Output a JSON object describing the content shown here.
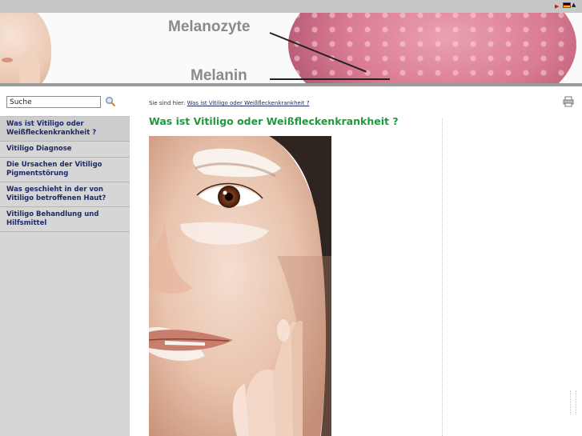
{
  "header": {
    "label_top": "Melanozyte",
    "label_bottom": "Melanin"
  },
  "colors": {
    "title_green": "#1f9a3a",
    "nav_text": "#1c2a66",
    "sidebar_bg": "#d6d6d6",
    "topbar_bg": "#c7c7c7",
    "flag": [
      "#000000",
      "#dd0000",
      "#ffce00"
    ]
  },
  "search": {
    "value": "Suche",
    "button_icon": "magnifier-icon"
  },
  "sidebar": {
    "items": [
      {
        "label": "Was ist Vitiligo oder Weißfleckenkrankheit ?",
        "active": true
      },
      {
        "label": "Vitiligo Diagnose",
        "active": false
      },
      {
        "label": "Die Ursachen der Vitiligo Pigmentstörung",
        "active": false
      },
      {
        "label": "Was geschieht in der von Vitiligo betroffenen Haut?",
        "active": false
      },
      {
        "label": "Vitiligo Behandlung und Hilfsmittel",
        "active": false
      }
    ]
  },
  "breadcrumb": {
    "prefix": "Sie sind hier:",
    "link": "Was ist Vitiligo oder Weißfleckenkrankheit ?"
  },
  "main": {
    "title": "Was ist Vitiligo oder Weißfleckenkrankheit ?"
  },
  "icons": {
    "print": "printer-icon",
    "language_arrow": "triangle-right-icon",
    "language_flag": "german-flag-icon",
    "dropdown": "chevron-down-icon"
  }
}
